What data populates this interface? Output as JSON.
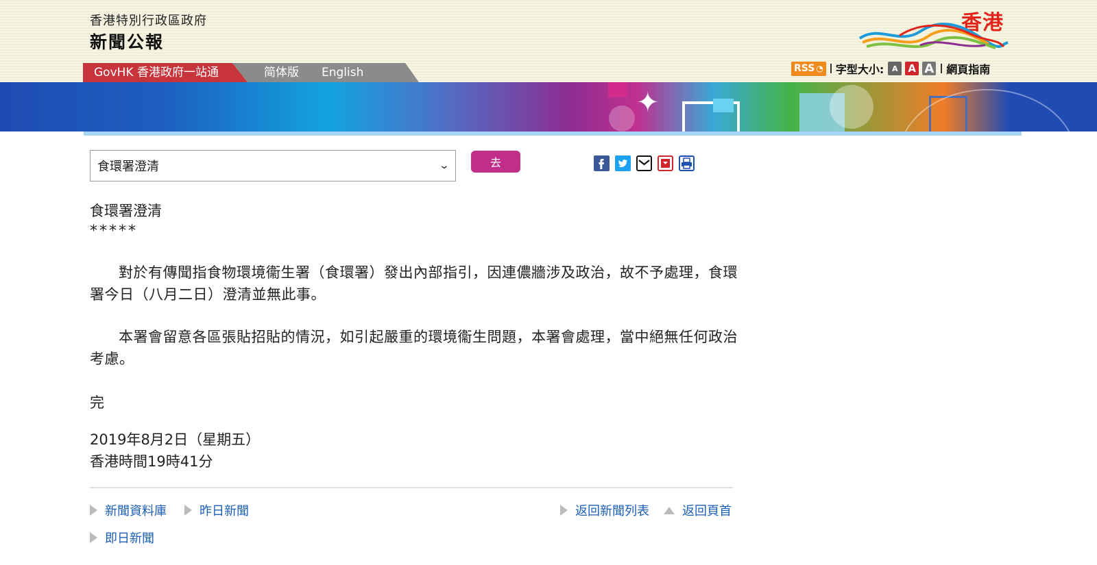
{
  "header": {
    "gov_name": "香港特別行政區政府",
    "site_title": "新聞公報",
    "brand_text": "香港"
  },
  "tabs": {
    "govhk": "GovHK 香港政府一站通",
    "simplified": "简体版",
    "english": "English"
  },
  "utility": {
    "rss": "RSS",
    "font_size_label": "字型大小:",
    "font_small": "A",
    "font_mid": "A",
    "font_large": "A",
    "guide": "網頁指南"
  },
  "controls": {
    "select_value": "食環署澄清",
    "go_label": "去"
  },
  "share_icons": [
    "facebook-icon",
    "twitter-icon",
    "email-icon",
    "bookmark-icon",
    "print-icon"
  ],
  "article": {
    "title": "食環署澄清",
    "stars": "*****",
    "para1": "對於有傳聞指食物環境衞生署（食環署）發出內部指引，因連儂牆涉及政治，故不予處理，食環署今日（八月二日）澄清並無此事。",
    "para2": "本署會留意各區張貼招貼的情況，如引起嚴重的環境衞生問題，本署會處理，當中絕無任何政治考慮。",
    "end": "完",
    "date": "2019年8月2日（星期五）",
    "time": "香港時間19時41分"
  },
  "footer_nav": {
    "archive": "新聞資料庫",
    "yesterday": "昨日新聞",
    "back_list": "返回新聞列表",
    "back_top": "返回頁首",
    "today": "即日新聞"
  },
  "colors": {
    "govhk_red": "#c8343b",
    "go_button": "#c02d8b",
    "link_blue": "#1c5fb8"
  }
}
